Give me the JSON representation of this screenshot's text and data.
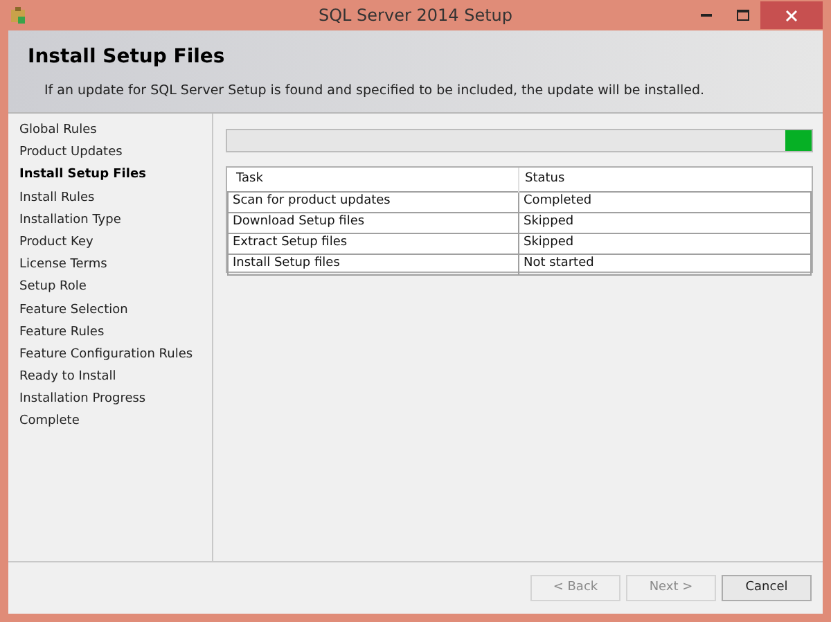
{
  "window": {
    "title": "SQL Server 2014 Setup"
  },
  "header": {
    "title": "Install Setup Files",
    "description": "If an update for SQL Server Setup is found and specified to be included, the update will be installed."
  },
  "sidebar": {
    "items": [
      {
        "label": "Global Rules",
        "selected": false
      },
      {
        "label": "Product Updates",
        "selected": false
      },
      {
        "label": "Install Setup Files",
        "selected": true
      },
      {
        "label": "Install Rules",
        "selected": false
      },
      {
        "label": "Installation Type",
        "selected": false
      },
      {
        "label": "Product Key",
        "selected": false
      },
      {
        "label": "License Terms",
        "selected": false
      },
      {
        "label": "Setup Role",
        "selected": false
      },
      {
        "label": "Feature Selection",
        "selected": false
      },
      {
        "label": "Feature Rules",
        "selected": false
      },
      {
        "label": "Feature Configuration Rules",
        "selected": false
      },
      {
        "label": "Ready to Install",
        "selected": false
      },
      {
        "label": "Installation Progress",
        "selected": false
      },
      {
        "label": "Complete",
        "selected": false
      }
    ]
  },
  "progress": {
    "level": 0.955
  },
  "table": {
    "columns": [
      "Task",
      "Status"
    ],
    "rows": [
      [
        "Scan for product updates",
        "Completed"
      ],
      [
        "Download Setup files",
        "Skipped"
      ],
      [
        "Extract Setup files",
        "Skipped"
      ],
      [
        "Install Setup files",
        "Not started"
      ]
    ]
  },
  "buttons": [
    {
      "label": "< Back",
      "disabled": true
    },
    {
      "label": "Next >",
      "disabled": true
    },
    {
      "label": "Cancel",
      "disabled": false
    }
  ]
}
